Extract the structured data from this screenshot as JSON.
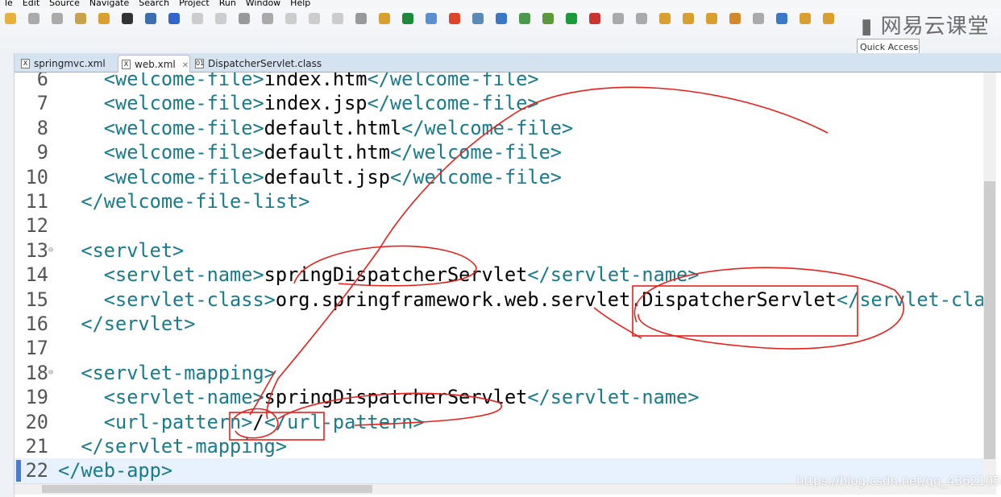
{
  "menu": [
    "le",
    "Edit",
    "Source",
    "Navigate",
    "Search",
    "Project",
    "Run",
    "Window",
    "Help"
  ],
  "quick_access": "Quick Access",
  "logo": "网易云课堂",
  "tabs": [
    {
      "label": "springmvc.xml",
      "icon": "xml-file-icon"
    },
    {
      "label": "web.xml",
      "icon": "xml-file-icon",
      "active": true
    },
    {
      "label": "DispatcherServlet.class",
      "icon": "class-file-icon"
    }
  ],
  "close_glyph": "✕",
  "lines": [
    {
      "n": "6",
      "indent": 4,
      "segs": [
        [
          "tag",
          "<welcome-file>"
        ],
        [
          "txt",
          "index.htm"
        ],
        [
          "tag",
          "</welcome-file>"
        ]
      ]
    },
    {
      "n": "7",
      "indent": 4,
      "segs": [
        [
          "tag",
          "<welcome-file>"
        ],
        [
          "txt",
          "index.jsp"
        ],
        [
          "tag",
          "</welcome-file>"
        ]
      ]
    },
    {
      "n": "8",
      "indent": 4,
      "segs": [
        [
          "tag",
          "<welcome-file>"
        ],
        [
          "txt",
          "default.html"
        ],
        [
          "tag",
          "</welcome-file>"
        ]
      ]
    },
    {
      "n": "9",
      "indent": 4,
      "segs": [
        [
          "tag",
          "<welcome-file>"
        ],
        [
          "txt",
          "default.htm"
        ],
        [
          "tag",
          "</welcome-file>"
        ]
      ]
    },
    {
      "n": "10",
      "indent": 4,
      "segs": [
        [
          "tag",
          "<welcome-file>"
        ],
        [
          "txt",
          "default.jsp"
        ],
        [
          "tag",
          "</welcome-file>"
        ]
      ]
    },
    {
      "n": "11",
      "indent": 2,
      "segs": [
        [
          "tag",
          "</welcome-file-list>"
        ]
      ]
    },
    {
      "n": "12",
      "indent": 0,
      "segs": []
    },
    {
      "n": "13",
      "indent": 2,
      "fold": true,
      "segs": [
        [
          "tag",
          "<servlet>"
        ]
      ]
    },
    {
      "n": "14",
      "indent": 4,
      "segs": [
        [
          "tag",
          "<servlet-name>"
        ],
        [
          "txt",
          "springDispatcherServlet"
        ],
        [
          "tag",
          "</servlet-name>"
        ]
      ]
    },
    {
      "n": "15",
      "indent": 4,
      "segs": [
        [
          "tag",
          "<servlet-class>"
        ],
        [
          "txt",
          "org.springframework.web.servlet.DispatcherServlet"
        ],
        [
          "tag",
          "</servlet-class>"
        ]
      ]
    },
    {
      "n": "16",
      "indent": 2,
      "segs": [
        [
          "tag",
          "</servlet>"
        ]
      ]
    },
    {
      "n": "17",
      "indent": 0,
      "segs": []
    },
    {
      "n": "18",
      "indent": 2,
      "fold": true,
      "segs": [
        [
          "tag",
          "<servlet-mapping>"
        ]
      ]
    },
    {
      "n": "19",
      "indent": 4,
      "segs": [
        [
          "tag",
          "<servlet-name>"
        ],
        [
          "txt",
          "springDispatcherServlet"
        ],
        [
          "tag",
          "</servlet-name>"
        ]
      ]
    },
    {
      "n": "20",
      "indent": 4,
      "segs": [
        [
          "tag",
          "<url-pattern>"
        ],
        [
          "txt",
          "/"
        ],
        [
          "tag",
          "</url-pattern>"
        ]
      ]
    },
    {
      "n": "21",
      "indent": 2,
      "segs": [
        [
          "tag",
          "</servlet-mapping>"
        ]
      ]
    },
    {
      "n": "22",
      "indent": 0,
      "current": true,
      "segs": [
        [
          "tag",
          "</web-app>"
        ]
      ]
    }
  ],
  "watermark": "https://blog.csdn.net/qq_43621055",
  "colors": {
    "tag": "#177b8c",
    "annotation": "#e8201a",
    "current_line": "#e8f2fe"
  }
}
